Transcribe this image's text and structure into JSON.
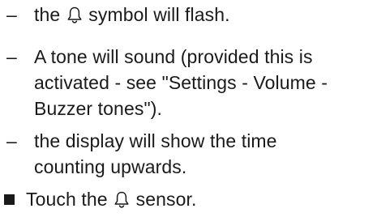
{
  "list": {
    "dash": "–",
    "items": [
      {
        "before": "the ",
        "after": " symbol will flash."
      },
      {
        "line1": "A tone will sound (provided this is",
        "line2": "activated - see \"Settings - Volume -",
        "line3": "Buzzer tones\")."
      },
      {
        "line1": "the display will show the time",
        "line2": "counting upwards."
      }
    ]
  },
  "instruction": {
    "before": "Touch the ",
    "after": " sensor."
  },
  "icons": {
    "bell": "bell-icon",
    "bullet": "square-bullet-icon"
  }
}
